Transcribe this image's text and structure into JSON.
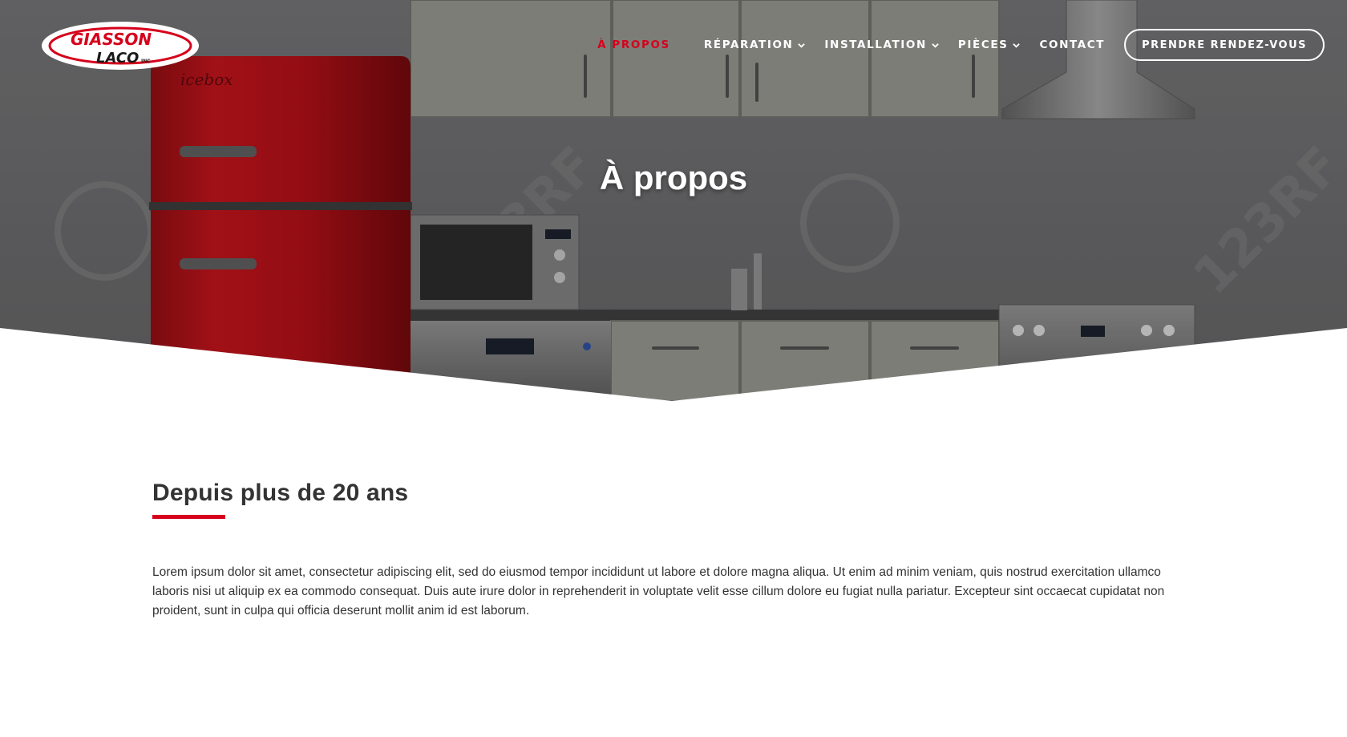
{
  "brand": {
    "logo_line1": "GIASSON",
    "logo_line2": "LACO",
    "logo_suffix": "INC",
    "accent_color": "#d6001c"
  },
  "nav": {
    "items": [
      {
        "label": "À PROPOS",
        "active": true
      },
      {
        "label": "RÉPARATION",
        "has_dropdown": true
      },
      {
        "label": "INSTALLATION",
        "has_dropdown": true
      },
      {
        "label": "PIÈCES",
        "has_dropdown": true
      },
      {
        "label": "CONTACT"
      }
    ],
    "cta_label": "PRENDRE RENDEZ-VOUS"
  },
  "hero": {
    "title": "À propos",
    "fridge_brand": "icebox",
    "watermark": "123RF"
  },
  "content": {
    "title": "Depuis plus de 20 ans",
    "body": "Lorem ipsum dolor sit amet, consectetur adipiscing elit, sed do eiusmod tempor incididunt ut labore et dolore magna aliqua. Ut enim ad minim veniam, quis nostrud exercitation ullamco laboris nisi ut aliquip ex ea commodo consequat. Duis aute irure dolor in reprehenderit in voluptate velit esse cillum dolore eu fugiat nulla pariatur. Excepteur sint occaecat cupidatat non proident, sunt in culpa qui officia deserunt mollit anim id est laborum."
  }
}
